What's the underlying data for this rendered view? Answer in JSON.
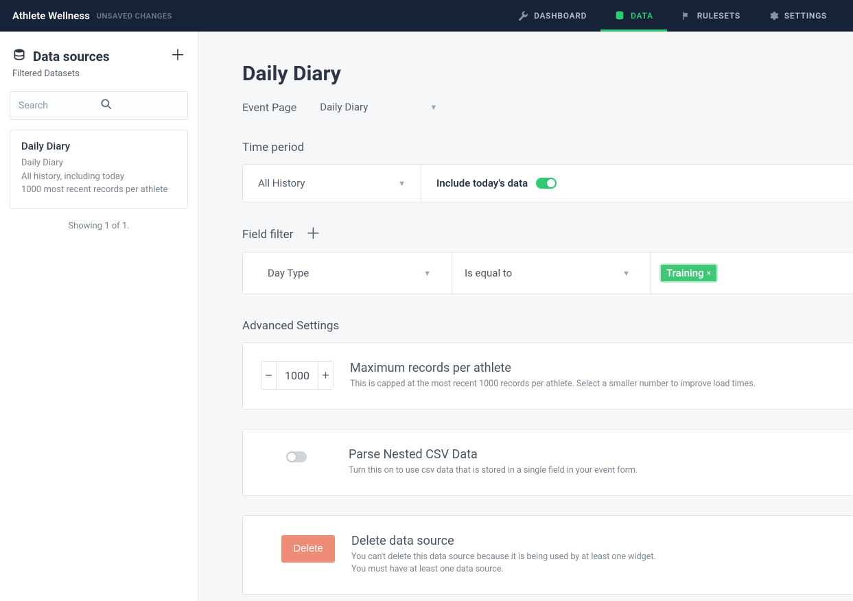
{
  "header": {
    "brand": "Athlete Wellness",
    "unsaved": "UNSAVED CHANGES",
    "nav": {
      "dashboard": "DASHBOARD",
      "data": "DATA",
      "rulesets": "RULESETS",
      "settings": "SETTINGS"
    }
  },
  "sidebar": {
    "title": "Data sources",
    "subtitle": "Filtered Datasets",
    "search_placeholder": "Search",
    "card": {
      "title": "Daily Diary",
      "line1": "Daily Diary",
      "line2": "All history, including today",
      "line3": "1000 most recent records per athlete"
    },
    "count": "Showing 1 of 1."
  },
  "main": {
    "title": "Daily Diary",
    "event_page_label": "Event Page",
    "event_page_value": "Daily Diary",
    "sections": {
      "time_period": "Time period",
      "field_filter": "Field filter",
      "advanced": "Advanced Settings"
    },
    "time": {
      "range": "All History",
      "include_label": "Include today's data",
      "include_on": true
    },
    "filter": {
      "field": "Day Type",
      "operator": "Is equal to",
      "value": "Training"
    },
    "adv": {
      "max": {
        "value": "1000",
        "title": "Maximum records per athlete",
        "desc": "This is capped at the most recent 1000 records per athlete. Select a smaller number to improve load times."
      },
      "csv": {
        "title": "Parse Nested CSV Data",
        "desc": "Turn this on to use csv data that is stored in a single field in your event form.",
        "on": false
      },
      "del": {
        "button": "Delete",
        "title": "Delete data source",
        "desc1": "You can't delete this data source because it is being used by at least one widget.",
        "desc2": "You must have at least one data source."
      }
    }
  }
}
